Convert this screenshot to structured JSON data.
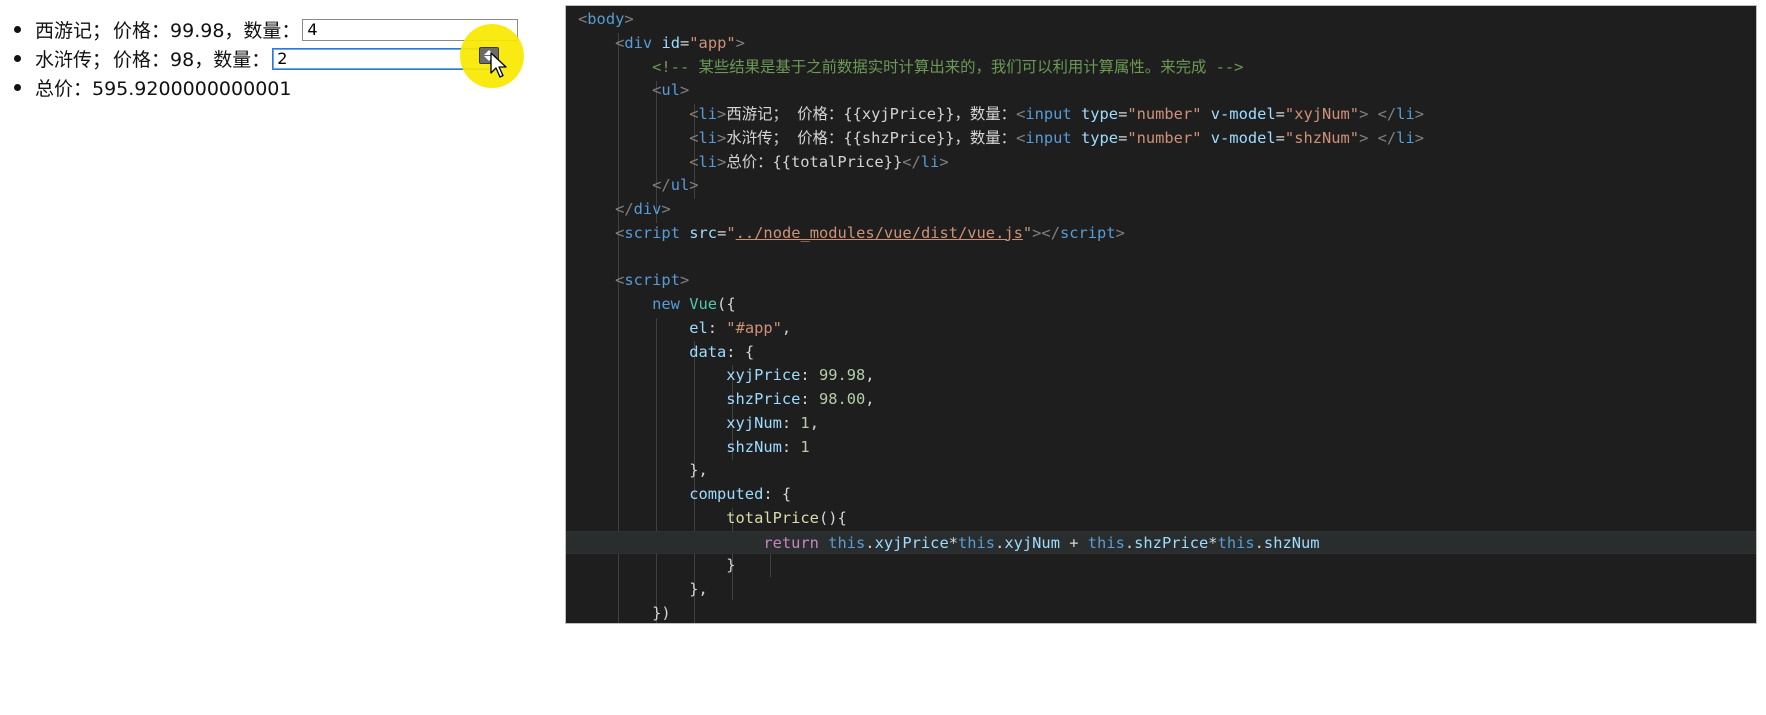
{
  "browser": {
    "items": [
      {
        "title": "西游记；",
        "price_label": "价格：99.98，数量：",
        "input_value": "4"
      },
      {
        "title": "水浒传；",
        "price_label": "价格：98，数量：",
        "input_value": "2"
      }
    ],
    "total_label": "总价：595.9200000000001"
  },
  "editor": {
    "lines": [
      [
        {
          "c": "t-bracket",
          "t": "<"
        },
        {
          "c": "t-tag",
          "t": "body"
        },
        {
          "c": "t-bracket",
          "t": ">"
        }
      ],
      [
        {
          "c": "t-text",
          "t": "    "
        },
        {
          "c": "t-bracket",
          "t": "<"
        },
        {
          "c": "t-tag",
          "t": "div"
        },
        {
          "c": "t-text",
          "t": " "
        },
        {
          "c": "t-attr",
          "t": "id"
        },
        {
          "c": "t-text",
          "t": "="
        },
        {
          "c": "t-str",
          "t": "\"app\""
        },
        {
          "c": "t-bracket",
          "t": ">"
        }
      ],
      [
        {
          "c": "t-text",
          "t": "        "
        },
        {
          "c": "t-comment",
          "t": "<!-- 某些结果是基于之前数据实时计算出来的，我们可以利用计算属性。来完成 -->"
        }
      ],
      [
        {
          "c": "t-text",
          "t": "        "
        },
        {
          "c": "t-bracket",
          "t": "<"
        },
        {
          "c": "t-tag",
          "t": "ul"
        },
        {
          "c": "t-bracket",
          "t": ">"
        }
      ],
      [
        {
          "c": "t-text",
          "t": "            "
        },
        {
          "c": "t-bracket",
          "t": "<"
        },
        {
          "c": "t-tag",
          "t": "li"
        },
        {
          "c": "t-bracket",
          "t": ">"
        },
        {
          "c": "t-text",
          "t": "西游记； 价格：{{xyjPrice}}，数量："
        },
        {
          "c": "t-bracket",
          "t": "<"
        },
        {
          "c": "t-tag",
          "t": "input"
        },
        {
          "c": "t-text",
          "t": " "
        },
        {
          "c": "t-attr",
          "t": "type"
        },
        {
          "c": "t-text",
          "t": "="
        },
        {
          "c": "t-str",
          "t": "\"number\""
        },
        {
          "c": "t-text",
          "t": " "
        },
        {
          "c": "t-attr",
          "t": "v-model"
        },
        {
          "c": "t-text",
          "t": "="
        },
        {
          "c": "t-str",
          "t": "\"xyjNum\""
        },
        {
          "c": "t-bracket",
          "t": ">"
        },
        {
          "c": "t-text",
          "t": " "
        },
        {
          "c": "t-bracket",
          "t": "</"
        },
        {
          "c": "t-tag",
          "t": "li"
        },
        {
          "c": "t-bracket",
          "t": ">"
        }
      ],
      [
        {
          "c": "t-text",
          "t": "            "
        },
        {
          "c": "t-bracket",
          "t": "<"
        },
        {
          "c": "t-tag",
          "t": "li"
        },
        {
          "c": "t-bracket",
          "t": ">"
        },
        {
          "c": "t-text",
          "t": "水浒传； 价格：{{shzPrice}}，数量："
        },
        {
          "c": "t-bracket",
          "t": "<"
        },
        {
          "c": "t-tag",
          "t": "input"
        },
        {
          "c": "t-text",
          "t": " "
        },
        {
          "c": "t-attr",
          "t": "type"
        },
        {
          "c": "t-text",
          "t": "="
        },
        {
          "c": "t-str",
          "t": "\"number\""
        },
        {
          "c": "t-text",
          "t": " "
        },
        {
          "c": "t-attr",
          "t": "v-model"
        },
        {
          "c": "t-text",
          "t": "="
        },
        {
          "c": "t-str",
          "t": "\"shzNum\""
        },
        {
          "c": "t-bracket",
          "t": ">"
        },
        {
          "c": "t-text",
          "t": " "
        },
        {
          "c": "t-bracket",
          "t": "</"
        },
        {
          "c": "t-tag",
          "t": "li"
        },
        {
          "c": "t-bracket",
          "t": ">"
        }
      ],
      [
        {
          "c": "t-text",
          "t": "            "
        },
        {
          "c": "t-bracket",
          "t": "<"
        },
        {
          "c": "t-tag",
          "t": "li"
        },
        {
          "c": "t-bracket",
          "t": ">"
        },
        {
          "c": "t-text",
          "t": "总价：{{totalPrice}}"
        },
        {
          "c": "t-bracket",
          "t": "</"
        },
        {
          "c": "t-tag",
          "t": "li"
        },
        {
          "c": "t-bracket",
          "t": ">"
        }
      ],
      [
        {
          "c": "t-text",
          "t": "        "
        },
        {
          "c": "t-bracket",
          "t": "</"
        },
        {
          "c": "t-tag",
          "t": "ul"
        },
        {
          "c": "t-bracket",
          "t": ">"
        }
      ],
      [
        {
          "c": "t-text",
          "t": "    "
        },
        {
          "c": "t-bracket",
          "t": "</"
        },
        {
          "c": "t-tag",
          "t": "div"
        },
        {
          "c": "t-bracket",
          "t": ">"
        }
      ],
      [
        {
          "c": "t-text",
          "t": "    "
        },
        {
          "c": "t-bracket",
          "t": "<"
        },
        {
          "c": "t-tag",
          "t": "script"
        },
        {
          "c": "t-text",
          "t": " "
        },
        {
          "c": "t-attr",
          "t": "src"
        },
        {
          "c": "t-text",
          "t": "="
        },
        {
          "c": "t-str",
          "t": "\""
        },
        {
          "c": "t-str t-link",
          "t": "../node_modules/vue/dist/vue.js"
        },
        {
          "c": "t-str",
          "t": "\""
        },
        {
          "c": "t-bracket",
          "t": "></"
        },
        {
          "c": "t-tag",
          "t": "script"
        },
        {
          "c": "t-bracket",
          "t": ">"
        }
      ],
      [
        {
          "c": "t-text",
          "t": ""
        }
      ],
      [
        {
          "c": "t-text",
          "t": "    "
        },
        {
          "c": "t-bracket",
          "t": "<"
        },
        {
          "c": "t-tag",
          "t": "script"
        },
        {
          "c": "t-bracket",
          "t": ">"
        }
      ],
      [
        {
          "c": "t-text",
          "t": "        "
        },
        {
          "c": "t-kw",
          "t": "new"
        },
        {
          "c": "t-text",
          "t": " "
        },
        {
          "c": "t-cls",
          "t": "Vue"
        },
        {
          "c": "t-text",
          "t": "({"
        }
      ],
      [
        {
          "c": "t-text",
          "t": "            "
        },
        {
          "c": "t-attr",
          "t": "el"
        },
        {
          "c": "t-text",
          "t": ": "
        },
        {
          "c": "t-str",
          "t": "\"#app\""
        },
        {
          "c": "t-text",
          "t": ","
        }
      ],
      [
        {
          "c": "t-text",
          "t": "            "
        },
        {
          "c": "t-attr",
          "t": "data"
        },
        {
          "c": "t-text",
          "t": ": {"
        }
      ],
      [
        {
          "c": "t-text",
          "t": "                "
        },
        {
          "c": "t-attr",
          "t": "xyjPrice"
        },
        {
          "c": "t-text",
          "t": ": "
        },
        {
          "c": "t-num",
          "t": "99.98"
        },
        {
          "c": "t-text",
          "t": ","
        }
      ],
      [
        {
          "c": "t-text",
          "t": "                "
        },
        {
          "c": "t-attr",
          "t": "shzPrice"
        },
        {
          "c": "t-text",
          "t": ": "
        },
        {
          "c": "t-num",
          "t": "98.00"
        },
        {
          "c": "t-text",
          "t": ","
        }
      ],
      [
        {
          "c": "t-text",
          "t": "                "
        },
        {
          "c": "t-attr",
          "t": "xyjNum"
        },
        {
          "c": "t-text",
          "t": ": "
        },
        {
          "c": "t-num",
          "t": "1"
        },
        {
          "c": "t-text",
          "t": ","
        }
      ],
      [
        {
          "c": "t-text",
          "t": "                "
        },
        {
          "c": "t-attr",
          "t": "shzNum"
        },
        {
          "c": "t-text",
          "t": ": "
        },
        {
          "c": "t-num",
          "t": "1"
        }
      ],
      [
        {
          "c": "t-text",
          "t": "            },"
        }
      ],
      [
        {
          "c": "t-text",
          "t": "            "
        },
        {
          "c": "t-attr",
          "t": "computed"
        },
        {
          "c": "t-text",
          "t": ": {"
        }
      ],
      [
        {
          "c": "t-text",
          "t": "                "
        },
        {
          "c": "t-fn",
          "t": "totalPrice"
        },
        {
          "c": "t-text",
          "t": "(){"
        }
      ],
      [
        {
          "c": "t-text",
          "t": "                    "
        },
        {
          "c": "t-ctrl",
          "t": "return"
        },
        {
          "c": "t-text",
          "t": " "
        },
        {
          "c": "t-kw",
          "t": "this"
        },
        {
          "c": "t-text",
          "t": "."
        },
        {
          "c": "t-attr",
          "t": "xyjPrice"
        },
        {
          "c": "t-text",
          "t": "*"
        },
        {
          "c": "t-kw",
          "t": "this"
        },
        {
          "c": "t-text",
          "t": "."
        },
        {
          "c": "t-attr",
          "t": "xyjNum"
        },
        {
          "c": "t-text",
          "t": " + "
        },
        {
          "c": "t-kw",
          "t": "this"
        },
        {
          "c": "t-text",
          "t": "."
        },
        {
          "c": "t-attr",
          "t": "shzPrice"
        },
        {
          "c": "t-text",
          "t": "*"
        },
        {
          "c": "t-kw",
          "t": "this"
        },
        {
          "c": "t-text",
          "t": "."
        },
        {
          "c": "t-attr",
          "t": "shzNum"
        }
      ],
      [
        {
          "c": "t-text",
          "t": "                }"
        }
      ],
      [
        {
          "c": "t-text",
          "t": "            },"
        }
      ],
      [
        {
          "c": "t-text",
          "t": "        })"
        }
      ]
    ],
    "active_line": 22,
    "colors": {
      "background": "#1e1e1e",
      "tag": "#569cd6",
      "attr": "#9cdcfe",
      "string": "#ce9178",
      "comment": "#6a9955",
      "number": "#b5cea8",
      "function": "#dcdcaa",
      "keyword_control": "#c586c0",
      "class": "#4ec9b0"
    }
  },
  "overlay": {
    "cursor_highlight_color": "#f8e800",
    "icons": [
      "spinner-icon",
      "mouse-pointer-icon"
    ]
  }
}
